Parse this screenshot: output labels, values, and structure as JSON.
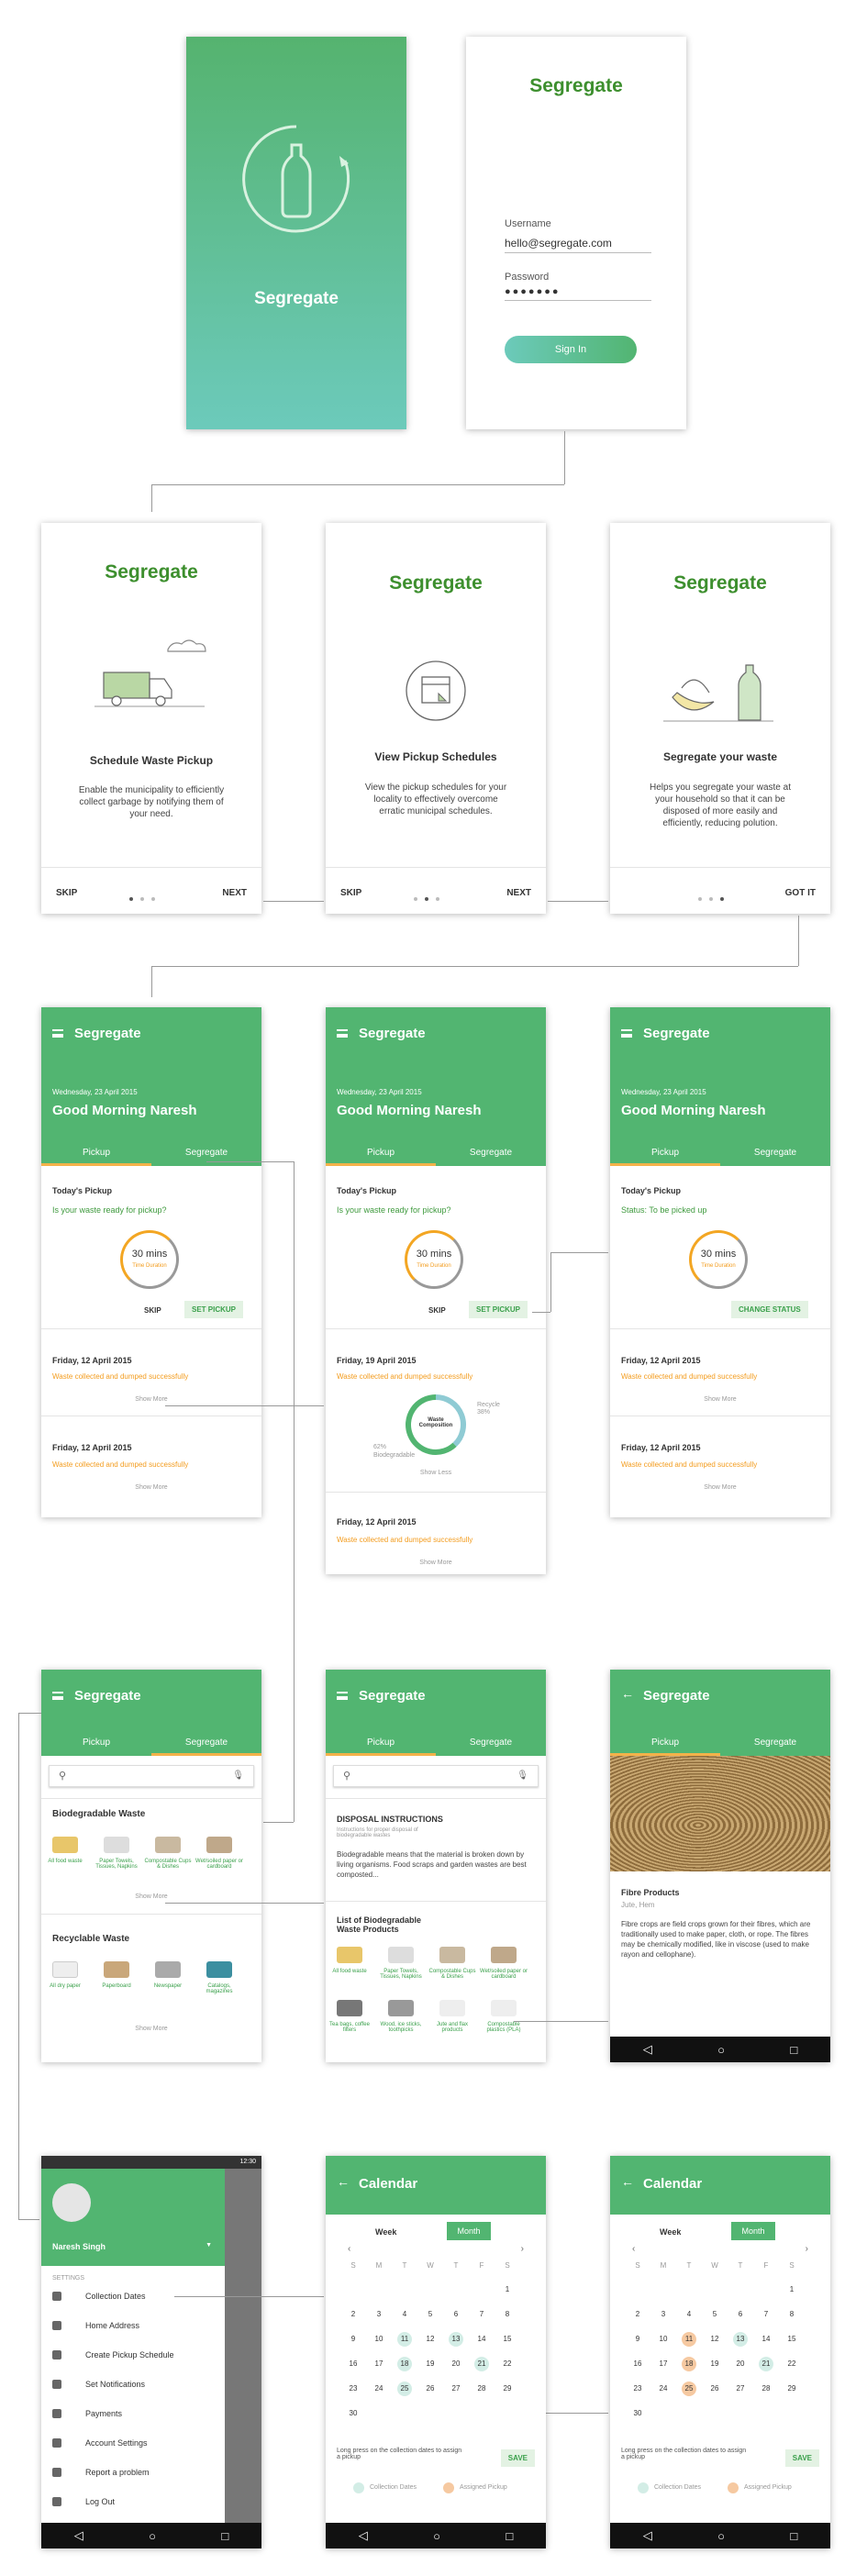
{
  "app_name": "Segregate",
  "login": {
    "username_label": "Username",
    "username_value": "hello@segregate.com",
    "password_label": "Password",
    "password_value": "●●●●●●●",
    "signin": "Sign In"
  },
  "onboarding": [
    {
      "title": "Schedule Waste Pickup",
      "body": "Enable the municipality to efficiently collect garbage by notifying them of your need.",
      "left": "SKIP",
      "right": "NEXT"
    },
    {
      "title": "View Pickup Schedules",
      "body": "View the pickup schedules for your locality to effectively overcome erratic municipal schedules.",
      "left": "SKIP",
      "right": "NEXT"
    },
    {
      "title": "Segregate your waste",
      "body": "Helps you segregate your waste at your household so that it can be disposed of more easily and efficiently, reducing polution.",
      "right": "GOT IT"
    }
  ],
  "home": {
    "date": "Wednesday, 23 April 2015",
    "greeting": "Good Morning Naresh",
    "tab_pickup": "Pickup",
    "tab_segregate": "Segregate",
    "today": "Today's Pickup",
    "question": "Is your waste ready for pickup?",
    "status": "Status: To be picked up",
    "timer": "30 mins",
    "timer_sub": "Time Duration",
    "skip": "SKIP",
    "set_pickup": "SET PICKUP",
    "change_status": "CHANGE STATUS",
    "hist_date1": "Friday, 12 April 2015",
    "hist_date2": "Friday, 19 April 2015",
    "hist_msg": "Waste collected and dumped successfully",
    "show_more": "Show More",
    "show_less": "Show Less",
    "chart_center": "Waste Composition",
    "recycle": "Recycle",
    "recycle_pct": "38%",
    "bio": "Biodegradable",
    "bio_pct": "62%"
  },
  "chart_data": {
    "type": "pie",
    "title": "Waste Composition",
    "categories": [
      "Recycle",
      "Biodegradable"
    ],
    "values": [
      38,
      62
    ]
  },
  "segregate": {
    "bio_title": "Biodegradable Waste",
    "recyc_title": "Recyclable Waste",
    "bio_items": [
      "All food waste",
      "Paper Towels, Tissues, Napkins",
      "Compostable Cups & Dishes",
      "Wet/soiled paper or cardboard"
    ],
    "recyc_items": [
      "All dry paper",
      "Paperboard",
      "Newspaper",
      "Catalogs, magazines"
    ],
    "more_items": [
      "Tea bags, coffee filters",
      "Wood, ice sticks, toothpicks",
      "Jute and flax products",
      "Compostable plastics (PLA)"
    ],
    "show_more": "Show More",
    "disposal_title": "DISPOSAL INSTRUCTIONS",
    "disposal_sub": "Instructions for proper disposal of biodegradable wastes",
    "disposal_body": "Biodegradable means that the material is broken down by living organisms. Food scraps and garden wastes are best composted...",
    "list_title": "List of Biodegradable Waste Products",
    "fibre_title": "Fibre Products",
    "fibre_sub": "Jute, Hem",
    "fibre_body": "Fibre crops are field crops grown for their fibres, which are traditionally used to make paper, cloth, or rope. The fibres may be chemically modified, like in viscose (used to make rayon and cellophane)."
  },
  "drawer": {
    "time": "12:30",
    "user": "Naresh Singh",
    "settings": "SETTINGS",
    "items": [
      "Collection Dates",
      "Home Address",
      "Create Pickup Schedule",
      "Set Notifications",
      "Payments",
      "Account Settings",
      "Report a problem",
      "Log Out"
    ]
  },
  "calendar": {
    "title": "Calendar",
    "week": "Week",
    "month": "Month",
    "days": [
      "S",
      "M",
      "T",
      "W",
      "T",
      "F",
      "S"
    ],
    "hint": "Long press on the collection dates to assign a pickup",
    "save": "SAVE",
    "legend_collection": "Collection Dates",
    "legend_assigned": "Assigned Pickup"
  }
}
